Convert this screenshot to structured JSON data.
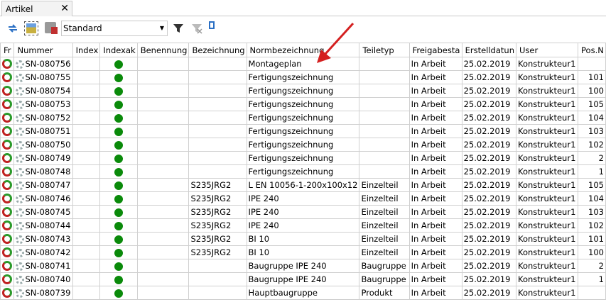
{
  "tab": {
    "title": "Artikel",
    "close": "✕"
  },
  "toolbar": {
    "view_select": "Standard"
  },
  "icons": {
    "refresh": "refresh-icon",
    "picture": "image-icon",
    "print": "print-icon",
    "filter": "filter-icon",
    "clear_filter": "clear-filter-icon",
    "columns": "columns-icon"
  },
  "colors": {
    "status_dot": "#0a8a0a",
    "arrow": "#d42020"
  },
  "columns": [
    "Fr",
    "Nummer",
    "Index",
    "Indexak",
    "Benennung",
    "Bezeichnung",
    "Normbezeichnung",
    "Teiletyp",
    "Freigabesta",
    "Erstelldatun",
    "User",
    "Pos.N"
  ],
  "rows": [
    {
      "nummer": "SN-080756",
      "bez": "",
      "norm": "Montageplan",
      "typ": "",
      "status": "In Arbeit",
      "datum": "25.02.2019",
      "user": "Konstrukteur1",
      "pos": ""
    },
    {
      "nummer": "SN-080755",
      "bez": "",
      "norm": "Fertigungszeichnung",
      "typ": "",
      "status": "In Arbeit",
      "datum": "25.02.2019",
      "user": "Konstrukteur1",
      "pos": "101"
    },
    {
      "nummer": "SN-080754",
      "bez": "",
      "norm": "Fertigungszeichnung",
      "typ": "",
      "status": "In Arbeit",
      "datum": "25.02.2019",
      "user": "Konstrukteur1",
      "pos": "100"
    },
    {
      "nummer": "SN-080753",
      "bez": "",
      "norm": "Fertigungszeichnung",
      "typ": "",
      "status": "In Arbeit",
      "datum": "25.02.2019",
      "user": "Konstrukteur1",
      "pos": "105"
    },
    {
      "nummer": "SN-080752",
      "bez": "",
      "norm": "Fertigungszeichnung",
      "typ": "",
      "status": "In Arbeit",
      "datum": "25.02.2019",
      "user": "Konstrukteur1",
      "pos": "104"
    },
    {
      "nummer": "SN-080751",
      "bez": "",
      "norm": "Fertigungszeichnung",
      "typ": "",
      "status": "In Arbeit",
      "datum": "25.02.2019",
      "user": "Konstrukteur1",
      "pos": "103"
    },
    {
      "nummer": "SN-080750",
      "bez": "",
      "norm": "Fertigungszeichnung",
      "typ": "",
      "status": "In Arbeit",
      "datum": "25.02.2019",
      "user": "Konstrukteur1",
      "pos": "102"
    },
    {
      "nummer": "SN-080749",
      "bez": "",
      "norm": "Fertigungszeichnung",
      "typ": "",
      "status": "In Arbeit",
      "datum": "25.02.2019",
      "user": "Konstrukteur1",
      "pos": "2"
    },
    {
      "nummer": "SN-080748",
      "bez": "",
      "norm": "Fertigungszeichnung",
      "typ": "",
      "status": "In Arbeit",
      "datum": "25.02.2019",
      "user": "Konstrukteur1",
      "pos": "1"
    },
    {
      "nummer": "SN-080747",
      "bez": "S235JRG2",
      "norm": "L EN 10056-1-200x100x12",
      "typ": "Einzelteil",
      "status": "In Arbeit",
      "datum": "25.02.2019",
      "user": "Konstrukteur1",
      "pos": "105"
    },
    {
      "nummer": "SN-080746",
      "bez": "S235JRG2",
      "norm": "IPE 240",
      "typ": "Einzelteil",
      "status": "In Arbeit",
      "datum": "25.02.2019",
      "user": "Konstrukteur1",
      "pos": "104"
    },
    {
      "nummer": "SN-080745",
      "bez": "S235JRG2",
      "norm": "IPE 240",
      "typ": "Einzelteil",
      "status": "In Arbeit",
      "datum": "25.02.2019",
      "user": "Konstrukteur1",
      "pos": "103"
    },
    {
      "nummer": "SN-080744",
      "bez": "S235JRG2",
      "norm": "IPE 240",
      "typ": "Einzelteil",
      "status": "In Arbeit",
      "datum": "25.02.2019",
      "user": "Konstrukteur1",
      "pos": "102"
    },
    {
      "nummer": "SN-080743",
      "bez": "S235JRG2",
      "norm": "BI 10",
      "typ": "Einzelteil",
      "status": "In Arbeit",
      "datum": "25.02.2019",
      "user": "Konstrukteur1",
      "pos": "101"
    },
    {
      "nummer": "SN-080742",
      "bez": "S235JRG2",
      "norm": "BI 10",
      "typ": "Einzelteil",
      "status": "In Arbeit",
      "datum": "25.02.2019",
      "user": "Konstrukteur1",
      "pos": "100"
    },
    {
      "nummer": "SN-080741",
      "bez": "",
      "norm": "Baugruppe IPE 240",
      "typ": "Baugruppe",
      "status": "In Arbeit",
      "datum": "25.02.2019",
      "user": "Konstrukteur1",
      "pos": "2"
    },
    {
      "nummer": "SN-080740",
      "bez": "",
      "norm": "Baugruppe IPE 240",
      "typ": "Baugruppe",
      "status": "In Arbeit",
      "datum": "25.02.2019",
      "user": "Konstrukteur1",
      "pos": "1"
    },
    {
      "nummer": "SN-080739",
      "bez": "",
      "norm": "Hauptbaugruppe",
      "typ": "Produkt",
      "status": "In Arbeit",
      "datum": "25.02.2019",
      "user": "Konstrukteur1",
      "pos": ""
    }
  ]
}
